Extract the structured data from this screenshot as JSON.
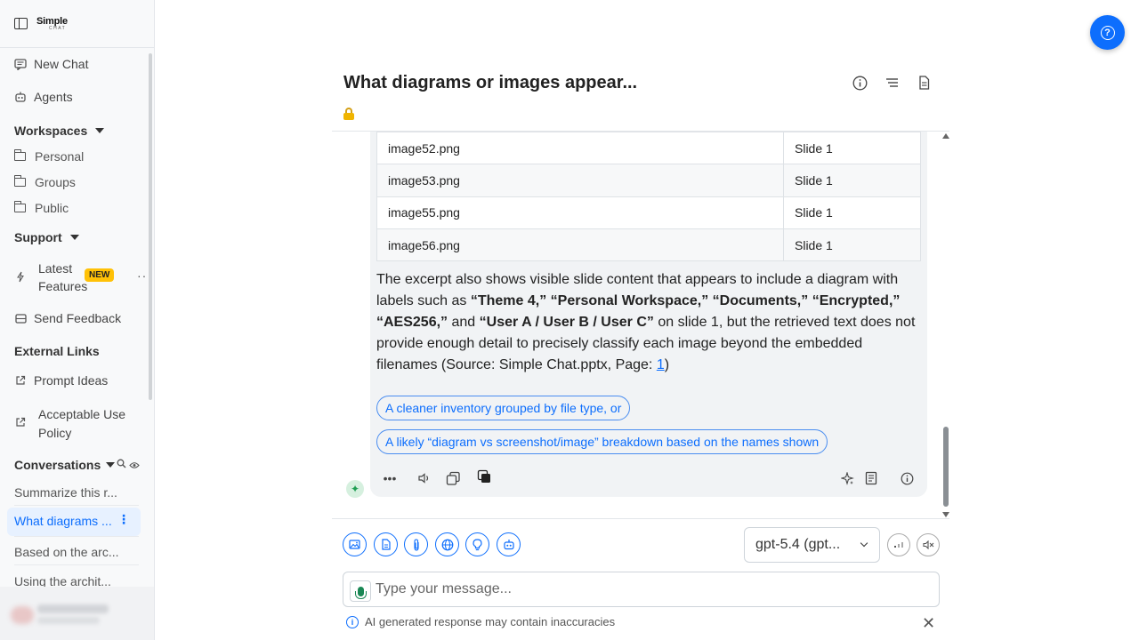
{
  "brand": {
    "line1": "Simple",
    "line2": "CHAT"
  },
  "sidebar": {
    "new_chat": "New Chat",
    "agents": "Agents",
    "workspaces": {
      "label": "Workspaces",
      "items": [
        "Personal",
        "Groups",
        "Public"
      ]
    },
    "support": {
      "label": "Support",
      "latest_line1": "Latest",
      "latest_line2": "Features",
      "badge": "NEW",
      "feedback": "Send Feedback"
    },
    "external": {
      "label": "External Links",
      "prompt_ideas": "Prompt Ideas",
      "aup_line1": "Acceptable Use",
      "aup_line2": "Policy"
    },
    "conversations": {
      "label": "Conversations",
      "items": [
        "Summarize this r...",
        "What diagrams ...",
        "Based on the arc...",
        "Using the archit..."
      ]
    }
  },
  "chat": {
    "title": "What diagrams or images appear...",
    "table_rows": [
      {
        "file": "image52.png",
        "slide": "Slide 1"
      },
      {
        "file": "image53.png",
        "slide": "Slide 1"
      },
      {
        "file": "image55.png",
        "slide": "Slide 1"
      },
      {
        "file": "image56.png",
        "slide": "Slide 1"
      }
    ],
    "para": {
      "t1": "The excerpt also shows visible slide content that appears to include a diagram with labels such as ",
      "b1": "“Theme 4,”",
      "b2": "“Personal Workspace,”",
      "b3": "“Documents,”",
      "b4": "“Encrypted,”",
      "b5": "“AES256,”",
      "t2": "and",
      "b6": "“User A / User B / User C”",
      "t3": " on slide 1, but the retrieved text does not provide enough detail to precisely classify each image beyond the embedded filenames (Source: Simple Chat.pptx, Page: ",
      "link": "1",
      "t4": ")"
    },
    "suggestions": [
      "A cleaner inventory grouped by file type, or",
      "A likely “diagram vs screenshot/image” breakdown based on the names shown"
    ]
  },
  "input": {
    "model": "gpt-5.4 (gpt...",
    "placeholder": "Type your message...",
    "disclaimer": "AI generated response may contain inaccuracies"
  },
  "colors": {
    "accent": "#0d6efd",
    "badge": "#ffc107",
    "active_bg": "#e7f1ff"
  }
}
